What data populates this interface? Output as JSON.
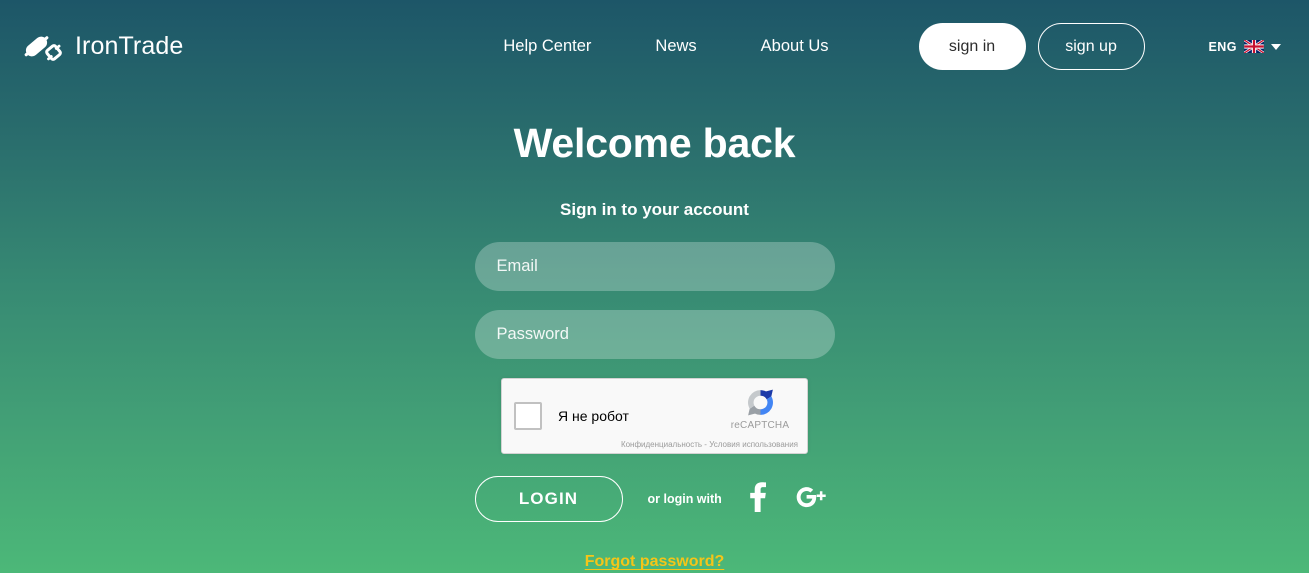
{
  "brand": {
    "name": "IronTrade",
    "icon": "candlestick-logo-icon"
  },
  "header": {
    "nav": [
      {
        "label": "Help Center",
        "name": "help-center"
      },
      {
        "label": "News",
        "name": "news"
      },
      {
        "label": "About Us",
        "name": "about-us"
      }
    ],
    "sign_in_label": "sign in",
    "sign_up_label": "sign up",
    "language": {
      "code": "ENG",
      "flag": "uk-flag-icon",
      "chevron": "chevron-down-icon"
    }
  },
  "main": {
    "title": "Welcome back",
    "subtitle": "Sign in to your account",
    "email": {
      "placeholder": "Email",
      "value": ""
    },
    "password": {
      "placeholder": "Password",
      "value": ""
    },
    "recaptcha": {
      "label": "Я не робот",
      "brand": "reCAPTCHA",
      "terms": "Конфиденциальность - Условия использования",
      "logo": "recaptcha-logo-icon",
      "checked": false
    },
    "login_label": "LOGIN",
    "or_login_with": "or login with",
    "social": [
      {
        "name": "facebook-icon",
        "label": "f"
      },
      {
        "name": "google-plus-icon",
        "label": "G+"
      }
    ],
    "forgot_password_label": "Forgot password?"
  },
  "colors": {
    "gradient_top": "#1d5668",
    "gradient_mid": "#378a73",
    "gradient_bottom": "#4cb878",
    "accent_link": "#f5c518",
    "white": "#ffffff",
    "field_fill": "rgba(255,255,255,0.26)",
    "recaptcha_bg": "#f9f9f9"
  }
}
